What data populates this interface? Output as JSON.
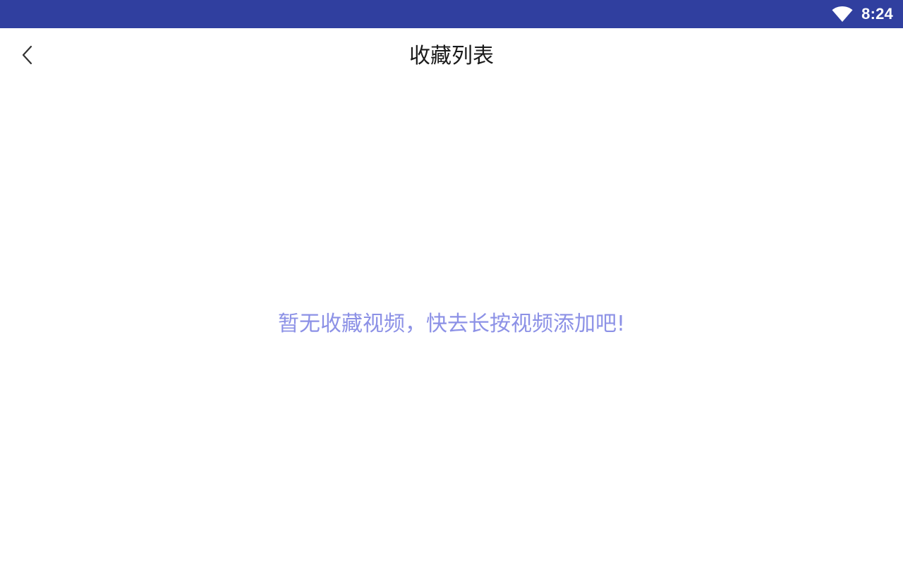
{
  "status_bar": {
    "time": "8:24",
    "wifi_icon": "wifi-icon",
    "background_color": "#303f9f"
  },
  "app_bar": {
    "title": "收藏列表",
    "back_icon": "chevron-left-icon"
  },
  "main": {
    "empty_message": "暂无收藏视频，快去长按视频添加吧!",
    "empty_message_color": "#8c91e6"
  }
}
